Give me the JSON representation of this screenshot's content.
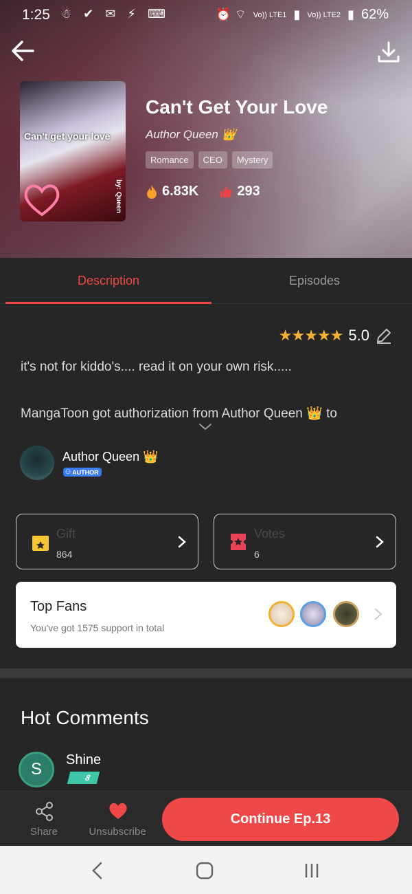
{
  "statusbar": {
    "time": "1:25",
    "left_icons": "☃ ✔ ✉ ⚡ ⌨",
    "right_icons": "⏰ ⌔",
    "net1": "Vo)) LTE1",
    "net2": "Vo)) LTE2",
    "battery": "62%"
  },
  "book": {
    "cover_title": "Can't get your love",
    "cover_by": "by: Queen",
    "title": "Can't Get Your Love",
    "author": "Author Queen 👑",
    "tags": [
      "Romance",
      "CEO",
      "Mystery"
    ],
    "views": "6.83K",
    "likes": "293"
  },
  "tabs": {
    "description": "Description",
    "episodes": "Episodes"
  },
  "rating": {
    "stars": "★★★★★",
    "value": "5.0"
  },
  "description": {
    "line1": "it's not for kiddo's.... read it on your own risk.....",
    "line2": "MangaToon got authorization from Author Queen 👑 to"
  },
  "author": {
    "name": "Author Queen 👑",
    "badge": "AUTHOR"
  },
  "gift": {
    "label": "Gift",
    "value": "864"
  },
  "votes": {
    "label": "Votes",
    "value": "6"
  },
  "top_fans": {
    "title": "Top Fans",
    "subtitle": "You've got 1575 support in total"
  },
  "hot_comments": {
    "title": "Hot Comments",
    "first": {
      "initial": "S",
      "name": "Shine",
      "level": "8"
    }
  },
  "actions": {
    "share": "Share",
    "unsubscribe": "Unsubscribe",
    "continue": "Continue Ep.13"
  },
  "colors": {
    "accent": "#f04848",
    "star": "#f6b233",
    "background": "#262626"
  }
}
